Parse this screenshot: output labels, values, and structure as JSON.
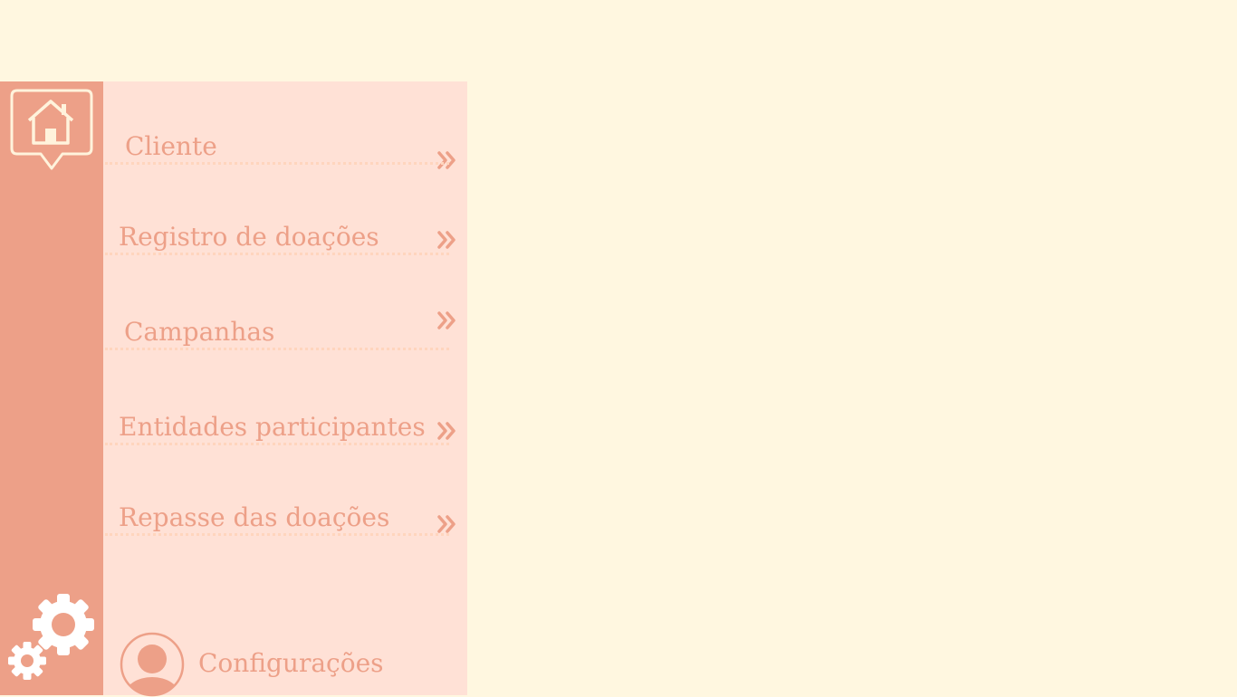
{
  "menu": {
    "items": [
      {
        "label": "Cliente"
      },
      {
        "label": "Registro de doações"
      },
      {
        "label": "Campanhas"
      },
      {
        "label": "Entidades participantes"
      },
      {
        "label": "Repasse das doações"
      }
    ]
  },
  "footer": {
    "settings_label": "Configurações"
  },
  "icons": {
    "home": "home-icon",
    "settings": "gears-icon",
    "avatar": "user-avatar-icon",
    "chevron": "double-chevron-right-icon"
  },
  "colors": {
    "page_background": "#FFF7E0",
    "rail_background": "#EDA088",
    "menu_background": "#FFE1D6",
    "accent": "#EDA088",
    "icon_light": "#FFF3DC"
  }
}
